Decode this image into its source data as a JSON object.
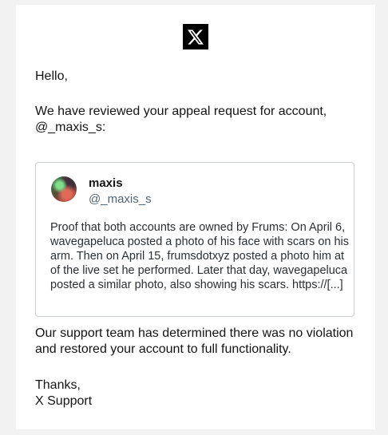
{
  "logo": {
    "icon": "x-logo-icon",
    "background": "#000000"
  },
  "email": {
    "greeting": "Hello,",
    "intro": "We have reviewed your appeal request for account, @_maxis_s:",
    "support_message": "Our support team has determined there was no violation and restored your account to full functionality.",
    "signoff_line1": "Thanks,",
    "signoff_line2": "X Support"
  },
  "quoted_post": {
    "display_name": "maxis",
    "handle": "@_maxis_s",
    "text": "Proof that both accounts are owned by Frums: On April 6, wavegapeluca posted a photo of his face with scars on his arm. Then on April 15, frumsdotxyz posted a photo him at of the live set he performed. Later that day, wavegapeluca posted a similar photo, also showing his scars. https://[...]"
  },
  "colors": {
    "page_background": "#f2f2f2",
    "card_background": "#ffffff",
    "text": "#141414",
    "handle_text": "#536471",
    "border": "#c9ced3"
  }
}
